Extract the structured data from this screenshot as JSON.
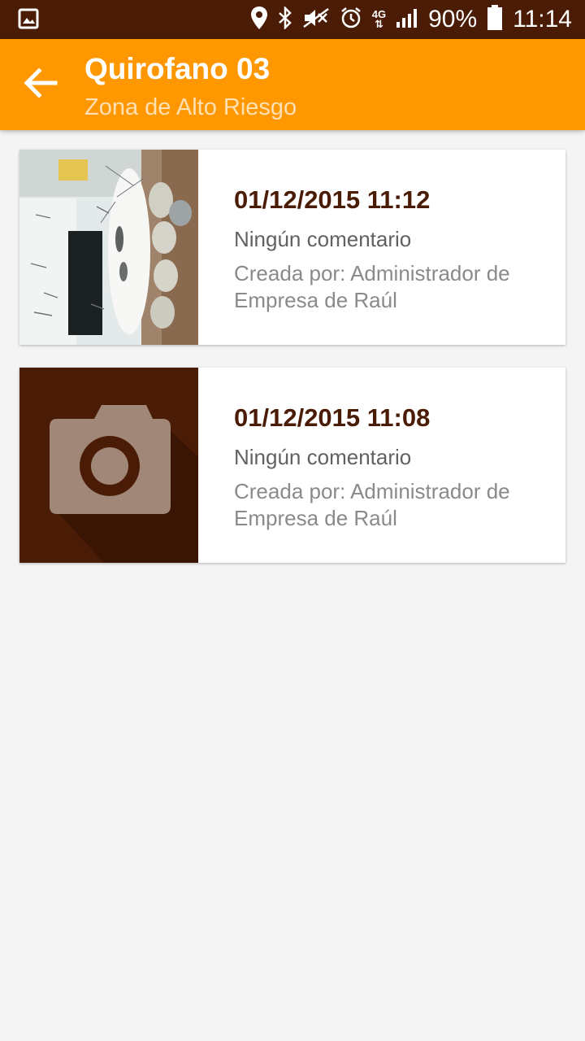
{
  "status_bar": {
    "battery": "90%",
    "time": "11:14",
    "network": "4G",
    "icons": [
      "gallery-icon",
      "location-icon",
      "bluetooth-icon",
      "mute-icon",
      "alarm-icon",
      "network-4g-icon",
      "signal-icon",
      "battery-icon"
    ]
  },
  "app_bar": {
    "title": "Quirofano 03",
    "subtitle": "Zona de Alto Riesgo",
    "back_icon": "arrow-back-icon"
  },
  "colors": {
    "status_bar": "#4a1c06",
    "app_bar": "#ff9800",
    "accent_dark": "#4a1c06",
    "background": "#f4f4f4"
  },
  "inspections": [
    {
      "date": "01/12/2015 11:12",
      "comment": "Ningún comentario",
      "author": "Creada por: Administrador de Empresa de Raúl",
      "thumbnail": "photo"
    },
    {
      "date": "01/12/2015 11:08",
      "comment": "Ningún comentario",
      "author": "Creada por: Administrador de Empresa de Raúl",
      "thumbnail": "camera-placeholder-icon"
    }
  ]
}
